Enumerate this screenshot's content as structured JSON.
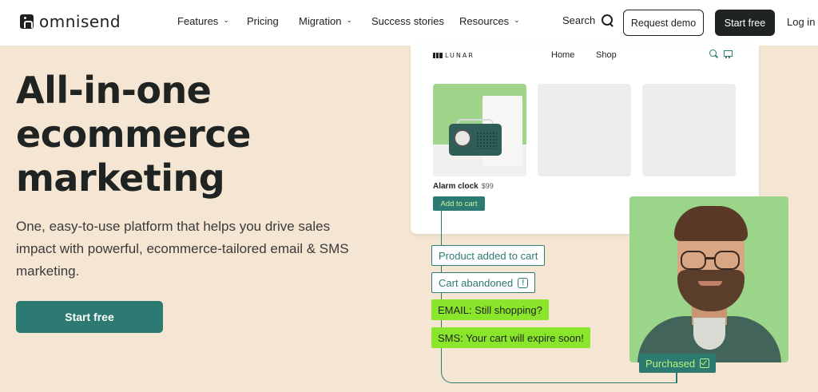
{
  "brand": {
    "name": "omnisend"
  },
  "nav": {
    "items": [
      {
        "label": "Features",
        "has_dropdown": true
      },
      {
        "label": "Pricing",
        "has_dropdown": false
      },
      {
        "label": "Migration",
        "has_dropdown": true
      },
      {
        "label": "Success stories",
        "has_dropdown": false
      },
      {
        "label": "Resources",
        "has_dropdown": true
      }
    ],
    "search_label": "Search",
    "request_demo": "Request demo",
    "start_free": "Start free",
    "login": "Log in",
    "chevron_glyph": "⌄"
  },
  "hero": {
    "title_lines": [
      "All-in-one",
      "ecommerce",
      "marketing"
    ],
    "subtitle": "One, easy-to-use platform that helps you drive sales impact with powerful, ecommerce-tailored email & SMS marketing.",
    "cta": "Start free"
  },
  "store": {
    "logo": "LUNAR",
    "nav": [
      "Home",
      "Shop"
    ],
    "product": {
      "name": "Alarm clock",
      "price": "$99"
    },
    "add_to_cart": "Add to cart"
  },
  "flow": {
    "steps": [
      {
        "label": "Product added to cart",
        "style": "outline"
      },
      {
        "label": "Cart abandoned",
        "style": "outline",
        "icon": "alert-icon",
        "icon_glyph": "!"
      },
      {
        "label": "EMAIL: Still shopping?",
        "style": "lime"
      },
      {
        "label": "SMS: Your cart will expire soon!",
        "style": "lime"
      }
    ],
    "final": {
      "label": "Purchased",
      "icon": "check-icon"
    }
  },
  "colors": {
    "background": "#f5e6d4",
    "accent": "#2d7a72",
    "lime": "#8ae62a",
    "dark_button": "#1f2322"
  }
}
